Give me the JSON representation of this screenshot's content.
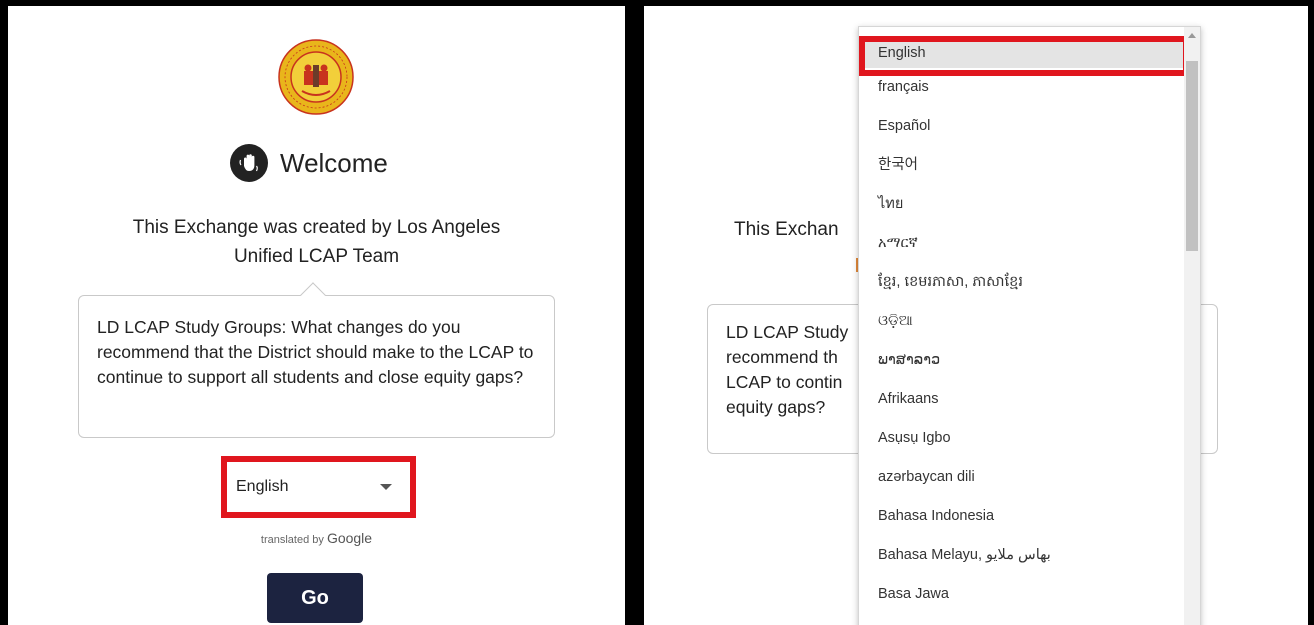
{
  "left": {
    "logo_name": "lausd-board-of-education-seal",
    "welcome": "Welcome",
    "exchange_line1": "This Exchange was created by Los Angeles",
    "exchange_line2": "Unified LCAP Team",
    "question": "LD LCAP Study Groups: What changes do you recommend that the District should make to the LCAP to continue to support all students and close equity gaps?",
    "language_selected": "English",
    "translated_by": "translated by",
    "google": "Google",
    "go_label": "Go"
  },
  "right": {
    "exchange_partial": "This Exchan",
    "card_lines": [
      "LD LCAP Study",
      "recommend th",
      "LCAP to contin",
      "equity gaps?"
    ],
    "languages": [
      "English",
      "français",
      "Español",
      "한국어",
      "ไทย",
      "አማርኛ",
      "ខ្មែរ, ខេមរភាសា, ភាសាខ្មែរ",
      "ଓଡ଼ିଆ",
      "ພາສາລາວ",
      "Afrikaans",
      "Asụsụ Igbo",
      "azərbaycan dili",
      "Bahasa Indonesia",
      "Bahasa Melayu, بهاس ملايو",
      "Basa Jawa"
    ]
  },
  "colors": {
    "highlight": "#e0161e",
    "go_button": "#1c2340",
    "accent_orange": "#e28a3c"
  }
}
